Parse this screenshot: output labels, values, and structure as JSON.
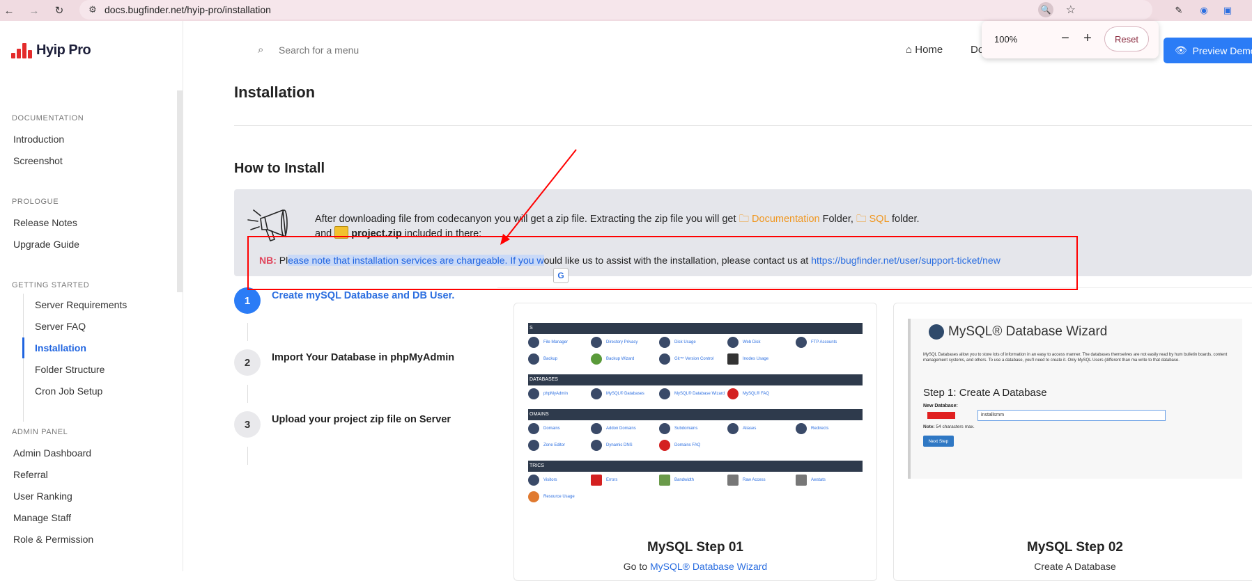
{
  "browser": {
    "url": "docs.bugfinder.net/hyip-pro/installation",
    "zoom_percent": "100%",
    "zoom_minus": "−",
    "zoom_plus": "+",
    "zoom_reset": "Reset"
  },
  "brand": {
    "name": "Hyip Pro",
    "color": "#e32b2b"
  },
  "search": {
    "placeholder": "Search for a menu"
  },
  "header": {
    "home": "Home",
    "docs": "Do",
    "preview": "Preview Demo"
  },
  "sidebar": {
    "sections": [
      {
        "title": "DOCUMENTATION",
        "items": [
          "Introduction",
          "Screenshot"
        ]
      },
      {
        "title": "PROLOGUE",
        "items": [
          "Release Notes",
          "Upgrade Guide"
        ]
      },
      {
        "title": "GETTING STARTED",
        "items": [
          "Server Requirements",
          "Server FAQ",
          "Installation",
          "Folder Structure",
          "Cron Job Setup"
        ]
      },
      {
        "title": "ADMIN PANEL",
        "items": [
          "Admin Dashboard",
          "Referral",
          "User Ranking",
          "Manage Staff",
          "Role & Permission"
        ]
      }
    ],
    "active": "Installation"
  },
  "page": {
    "title": "Installation",
    "section": "How to Install"
  },
  "notice": {
    "line1_a": "After downloading file from codecanyon you will get a zip file. Extracting the zip file you will get ",
    "doc_folder": "Documentation",
    "line1_b": " Folder, ",
    "sql_folder": "SQL",
    "line1_c": " folder.",
    "line2_a": "and ",
    "zip": "project.zip",
    "line2_b": " included in there:",
    "nb_label": "NB:",
    "nb_pre": " Pl",
    "nb_highlight": "ease note that installation services are chargeable. If you w",
    "nb_post": "ould like us to assist with the installation, please contact us at ",
    "nb_link": "https://bugfinder.net/user/support-ticket/new"
  },
  "steps": [
    {
      "num": "1",
      "label": "Create mySQL Database and DB User."
    },
    {
      "num": "2",
      "label": "Import Your Database in phpMyAdmin"
    },
    {
      "num": "3",
      "label": "Upload your project zip file on Server"
    }
  ],
  "cards": [
    {
      "title": "MySQL Step 01",
      "sub_pre": "Go to ",
      "sub_link": "MySQL® Database Wizard"
    },
    {
      "title": "MySQL Step 02",
      "sub_pre": "Create A Database",
      "sub_link": ""
    }
  ],
  "cpanel": {
    "bars": [
      "S",
      "DATABASES",
      "OMAINS",
      "TRICS"
    ],
    "rows": [
      [
        "File Manager",
        "Directory Privacy",
        "Disk Usage",
        "Web Disk",
        "FTP Accounts"
      ],
      [
        "Backup",
        "Backup Wizard",
        "Git™ Version Control",
        "Inodes Usage"
      ],
      [
        "phpMyAdmin",
        "MySQL® Databases",
        "MySQL® Database Wizard",
        "MySQL® FAQ"
      ],
      [
        "Domains",
        "Addon Domains",
        "Subdomains",
        "Aliases",
        "Redirects"
      ],
      [
        "Zone Editor",
        "Dynamic DNS",
        "Domains FAQ"
      ],
      [
        "Visitors",
        "Errors",
        "Bandwidth",
        "Raw Access",
        "Awstats"
      ],
      [
        "Resource Usage"
      ]
    ]
  },
  "wizard": {
    "title": "MySQL® Database Wizard",
    "desc": "MySQL Databases allow you to store lots of information in an easy to access manner. The databases themselves are not easily read by hum bulletin boards, content management systems, and others. To use a database, you'll need to create it. Only MySQL Users (different than ma write to that database.",
    "step": "Step 1: Create A Database",
    "new_db_label": "New Database:",
    "new_db_value": "installsmm",
    "note_label": "Note:",
    "note_text": " 54 characters max.",
    "next": "Next Step"
  }
}
